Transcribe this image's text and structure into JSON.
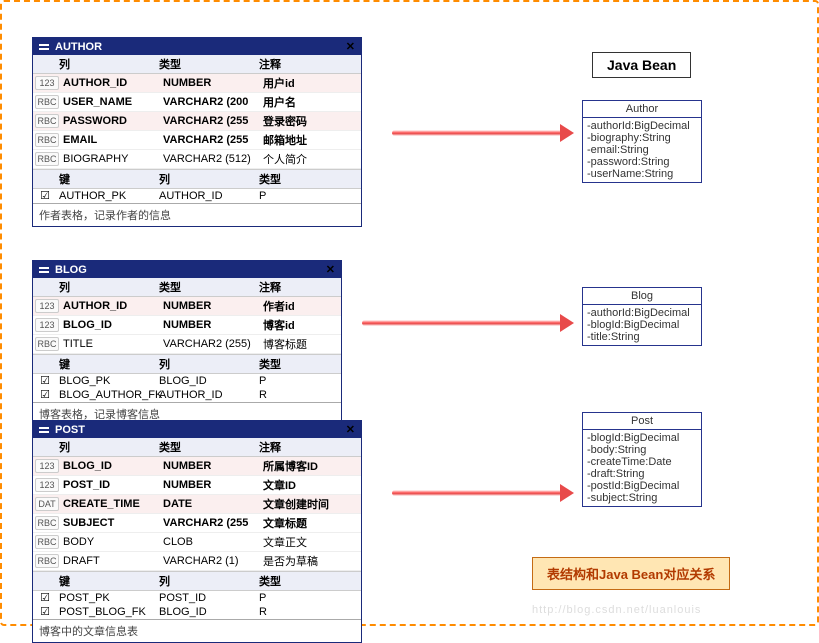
{
  "beanTitle": "Java Bean",
  "caption": "表结构和Java Bean对应关系",
  "watermark": "http://blog.csdn.net/luanlouis",
  "headers": {
    "col": "列",
    "type": "类型",
    "note": "注释",
    "key": "键"
  },
  "tables": {
    "author": {
      "title": "AUTHOR",
      "rows": [
        {
          "icon": "123",
          "name": "AUTHOR_ID",
          "type": "NUMBER",
          "note": "用户id",
          "alt": true
        },
        {
          "icon": "RBC",
          "name": "USER_NAME",
          "type": "VARCHAR2 (200",
          "note": "用户名",
          "alt": false
        },
        {
          "icon": "RBC",
          "name": "PASSWORD",
          "type": "VARCHAR2 (255",
          "note": "登录密码",
          "alt": true
        },
        {
          "icon": "RBC",
          "name": "EMAIL",
          "type": "VARCHAR2 (255",
          "note": "邮箱地址",
          "alt": false
        },
        {
          "icon": "RBC",
          "name": "BIOGRAPHY",
          "type": "VARCHAR2 (512)",
          "note": "个人简介",
          "alt": false,
          "plain": true
        }
      ],
      "keys": [
        {
          "chk": "☑",
          "name": "AUTHOR_PK",
          "col": "AUTHOR_ID",
          "t": "P"
        }
      ],
      "foot": "作者表格，记录作者的信息"
    },
    "blog": {
      "title": "BLOG",
      "rows": [
        {
          "icon": "123",
          "name": "AUTHOR_ID",
          "type": "NUMBER",
          "note": "作者id",
          "alt": true
        },
        {
          "icon": "123",
          "name": "BLOG_ID",
          "type": "NUMBER",
          "note": "博客id",
          "alt": false
        },
        {
          "icon": "RBC",
          "name": "TITLE",
          "type": "VARCHAR2 (255)",
          "note": "博客标题",
          "alt": false,
          "plain": true
        }
      ],
      "keys": [
        {
          "chk": "☑",
          "name": "BLOG_PK",
          "col": "BLOG_ID",
          "t": "P"
        },
        {
          "chk": "☑",
          "name": "BLOG_AUTHOR_FK",
          "col": "AUTHOR_ID",
          "t": "R"
        }
      ],
      "foot": "博客表格，记录博客信息"
    },
    "post": {
      "title": "POST",
      "rows": [
        {
          "icon": "123",
          "name": "BLOG_ID",
          "type": "NUMBER",
          "note": "所属博客ID",
          "alt": true
        },
        {
          "icon": "123",
          "name": "POST_ID",
          "type": "NUMBER",
          "note": "文章ID",
          "alt": false
        },
        {
          "icon": "DAT",
          "name": "CREATE_TIME",
          "type": "DATE",
          "note": "文章创建时间",
          "alt": true
        },
        {
          "icon": "RBC",
          "name": "SUBJECT",
          "type": "VARCHAR2 (255",
          "note": "文章标题",
          "alt": false
        },
        {
          "icon": "RBC",
          "name": "BODY",
          "type": "CLOB",
          "note": "文章正文",
          "alt": false,
          "plain": true
        },
        {
          "icon": "RBC",
          "name": "DRAFT",
          "type": "VARCHAR2 (1)",
          "note": "是否为草稿",
          "alt": false,
          "plain": true
        }
      ],
      "keys": [
        {
          "chk": "☑",
          "name": "POST_PK",
          "col": "POST_ID",
          "t": "P"
        },
        {
          "chk": "☑",
          "name": "POST_BLOG_FK",
          "col": "BLOG_ID",
          "t": "R"
        }
      ],
      "foot": "博客中的文章信息表"
    }
  },
  "beans": {
    "author": {
      "title": "Author",
      "fields": [
        "-authorId:BigDecimal",
        "-biography:String",
        "-email:String",
        "-password:String",
        "-userName:String"
      ]
    },
    "blog": {
      "title": "Blog",
      "fields": [
        "-authorId:BigDecimal",
        "-blogId:BigDecimal",
        "-title:String"
      ]
    },
    "post": {
      "title": "Post",
      "fields": [
        "-blogId:BigDecimal",
        "-body:String",
        "-createTime:Date",
        "-draft:String",
        "-postId:BigDecimal",
        "-subject:String"
      ]
    }
  }
}
